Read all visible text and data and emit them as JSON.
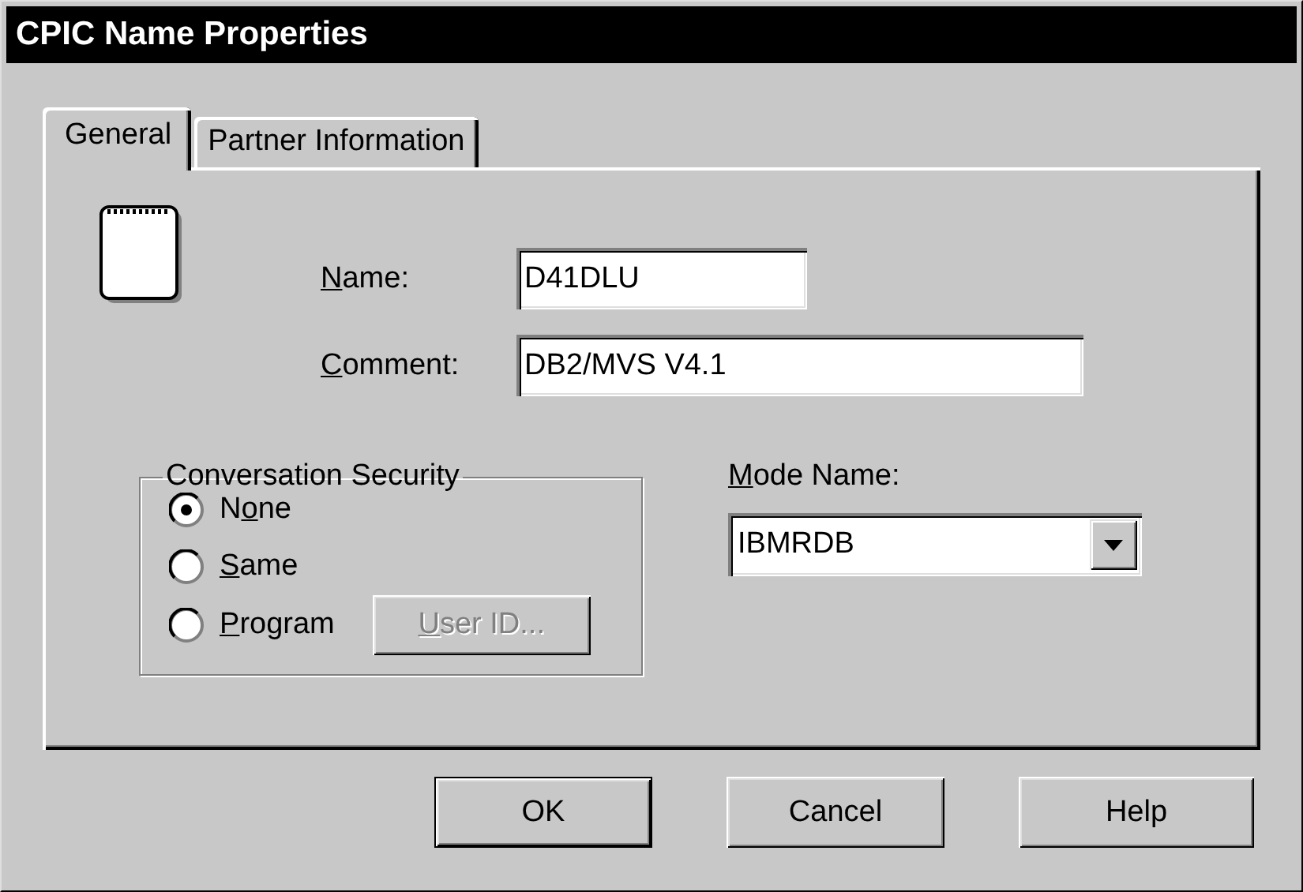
{
  "window": {
    "title": "CPIC Name Properties"
  },
  "tabs": [
    {
      "label": "General",
      "selected": true
    },
    {
      "label": "Partner Information",
      "selected": false
    }
  ],
  "fields": [
    {
      "label": {
        "key": "N",
        "after": "ame:"
      },
      "value": "D41DLU"
    },
    {
      "label": {
        "key": "C",
        "after": "omment:"
      },
      "value": "DB2/MVS V4.1"
    }
  ],
  "conversation_security": {
    "title": "Conversation Security",
    "options": [
      {
        "label": {
          "before": "N",
          "key": "o",
          "after": "ne"
        },
        "selected": true
      },
      {
        "label": {
          "key": "S",
          "after": "ame"
        },
        "selected": false
      },
      {
        "label": {
          "key": "P",
          "after": "rogram"
        },
        "selected": false
      }
    ],
    "user_id_button": {
      "label": {
        "key": "U",
        "after": "ser ID..."
      },
      "disabled": true
    }
  },
  "mode_name": {
    "label": {
      "key": "M",
      "after": "ode Name:"
    },
    "value": "IBMRDB"
  },
  "buttons": [
    {
      "label": "OK",
      "default": true
    },
    {
      "label": "Cancel",
      "default": false
    },
    {
      "label": "Help",
      "default": false
    }
  ]
}
